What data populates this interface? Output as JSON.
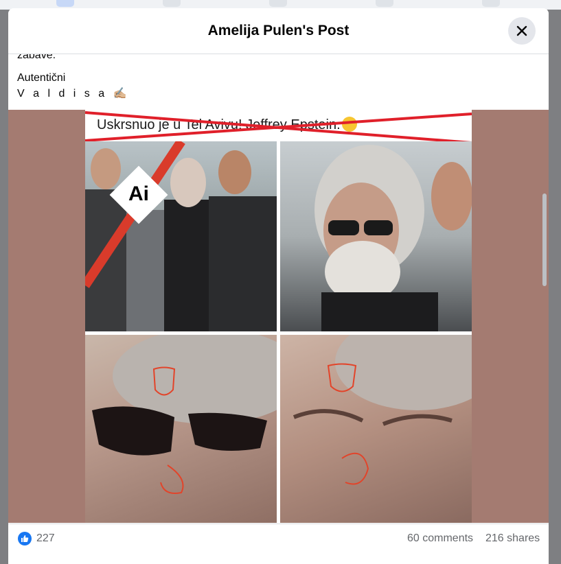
{
  "modal": {
    "title": "Amelija Pulen's Post",
    "close_icon": "close-icon"
  },
  "post": {
    "text_partial": "zabave.",
    "line1": "Autentični",
    "line2": "V a l d i s a ✍🏼"
  },
  "image": {
    "headline": "Uskrsnuo je u Tel Avivu! Jeffrey Epstein.",
    "ai_badge": "Ai"
  },
  "stats": {
    "likes": "227",
    "comments": "60 comments",
    "shares": "216 shares"
  },
  "colors": {
    "accent": "#1877f2",
    "image_bg": "#a47b71",
    "strike": "#e0202a"
  }
}
